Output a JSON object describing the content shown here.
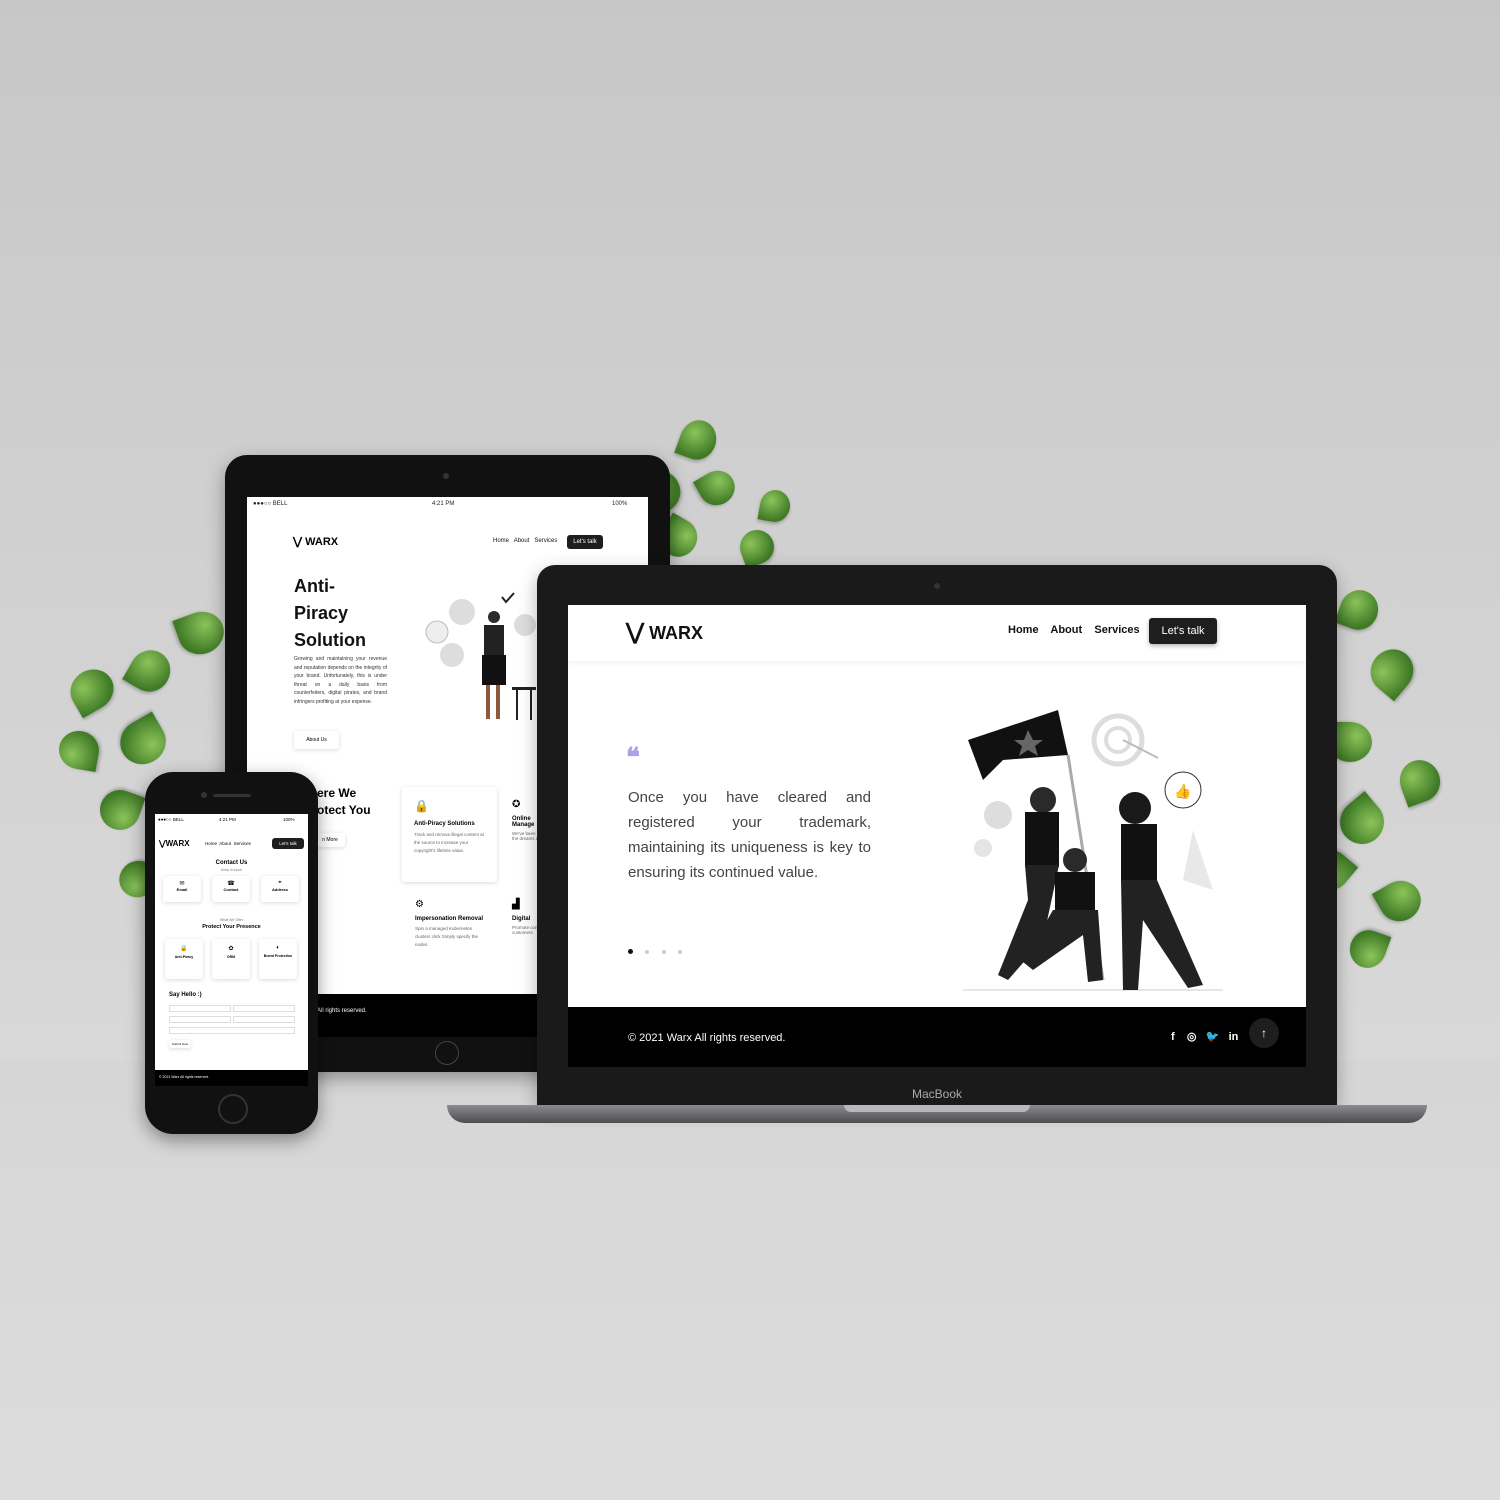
{
  "brand": {
    "name": "WARX",
    "device_label": "MacBook"
  },
  "nav": {
    "home": "Home",
    "about": "About",
    "services": "Services",
    "cta": "Let's talk"
  },
  "status": {
    "carrier": "●●●○○ BELL",
    "time": "4:21 PM",
    "battery": "100%"
  },
  "laptop": {
    "quote": "Once you have cleared and registered your trademark, maintaining its uniqueness is key to ensuring its continued value.",
    "quote_mark": "❝",
    "slides": {
      "count": 4,
      "active": 1
    },
    "footer": "© 2021 Warx All rights reserved.",
    "social": [
      "f",
      "◎",
      "🐦",
      "in"
    ],
    "scroll_top": "↑"
  },
  "tablet": {
    "hero_title_1": "Anti-",
    "hero_title_2": "Piracy",
    "hero_title_3": "Solution",
    "hero_text": "Growing and maintaining your revenue and reputation depends on the integrity of your brand. Unfortunately, this is under threat on a daily basis from counterfeiters, digital pirates, and brand infringers profiting at your expense.",
    "about_btn": "About Us",
    "section_title_1": "ere We",
    "section_title_2": "otect You",
    "learn_btn": "n More",
    "services": [
      {
        "title": "Anti-Piracy Solutions",
        "text": "Track and remove illegal content at the source to increase your copyright's lifetime value."
      },
      {
        "title": "Online Manage",
        "text": "We've been secure the dreams an"
      },
      {
        "title": "Impersonation Removal",
        "text": "Spin a managed Kubernetes clusters click Simply specify the nodes."
      },
      {
        "title": "Digital",
        "text": "Promote connect customers"
      }
    ],
    "footer": "All rights reserved."
  },
  "phone": {
    "contact_title": "Contact Us",
    "contact_sub": "Keep in touch",
    "contacts": [
      {
        "label": "Email",
        "icon": "✉"
      },
      {
        "label": "Contact",
        "icon": "☎"
      },
      {
        "label": "Address",
        "icon": "⌖"
      }
    ],
    "protect_sub": "What We Offer",
    "protect_title": "Protect Your Presence",
    "protect_cards": [
      {
        "label": "Anti-Piracy",
        "icon": "🔒"
      },
      {
        "label": "ORM",
        "icon": "✿"
      },
      {
        "label": "Brand Protection",
        "icon": "◐"
      }
    ],
    "say_hello": "Say Hello :)",
    "submit": "Submit Now",
    "footer": "© 2021 Warx All rights reserved."
  },
  "colors": {
    "accent_quote": "#a9a3e6",
    "dark": "#1e1e1e",
    "footer_bg": "#000000"
  }
}
